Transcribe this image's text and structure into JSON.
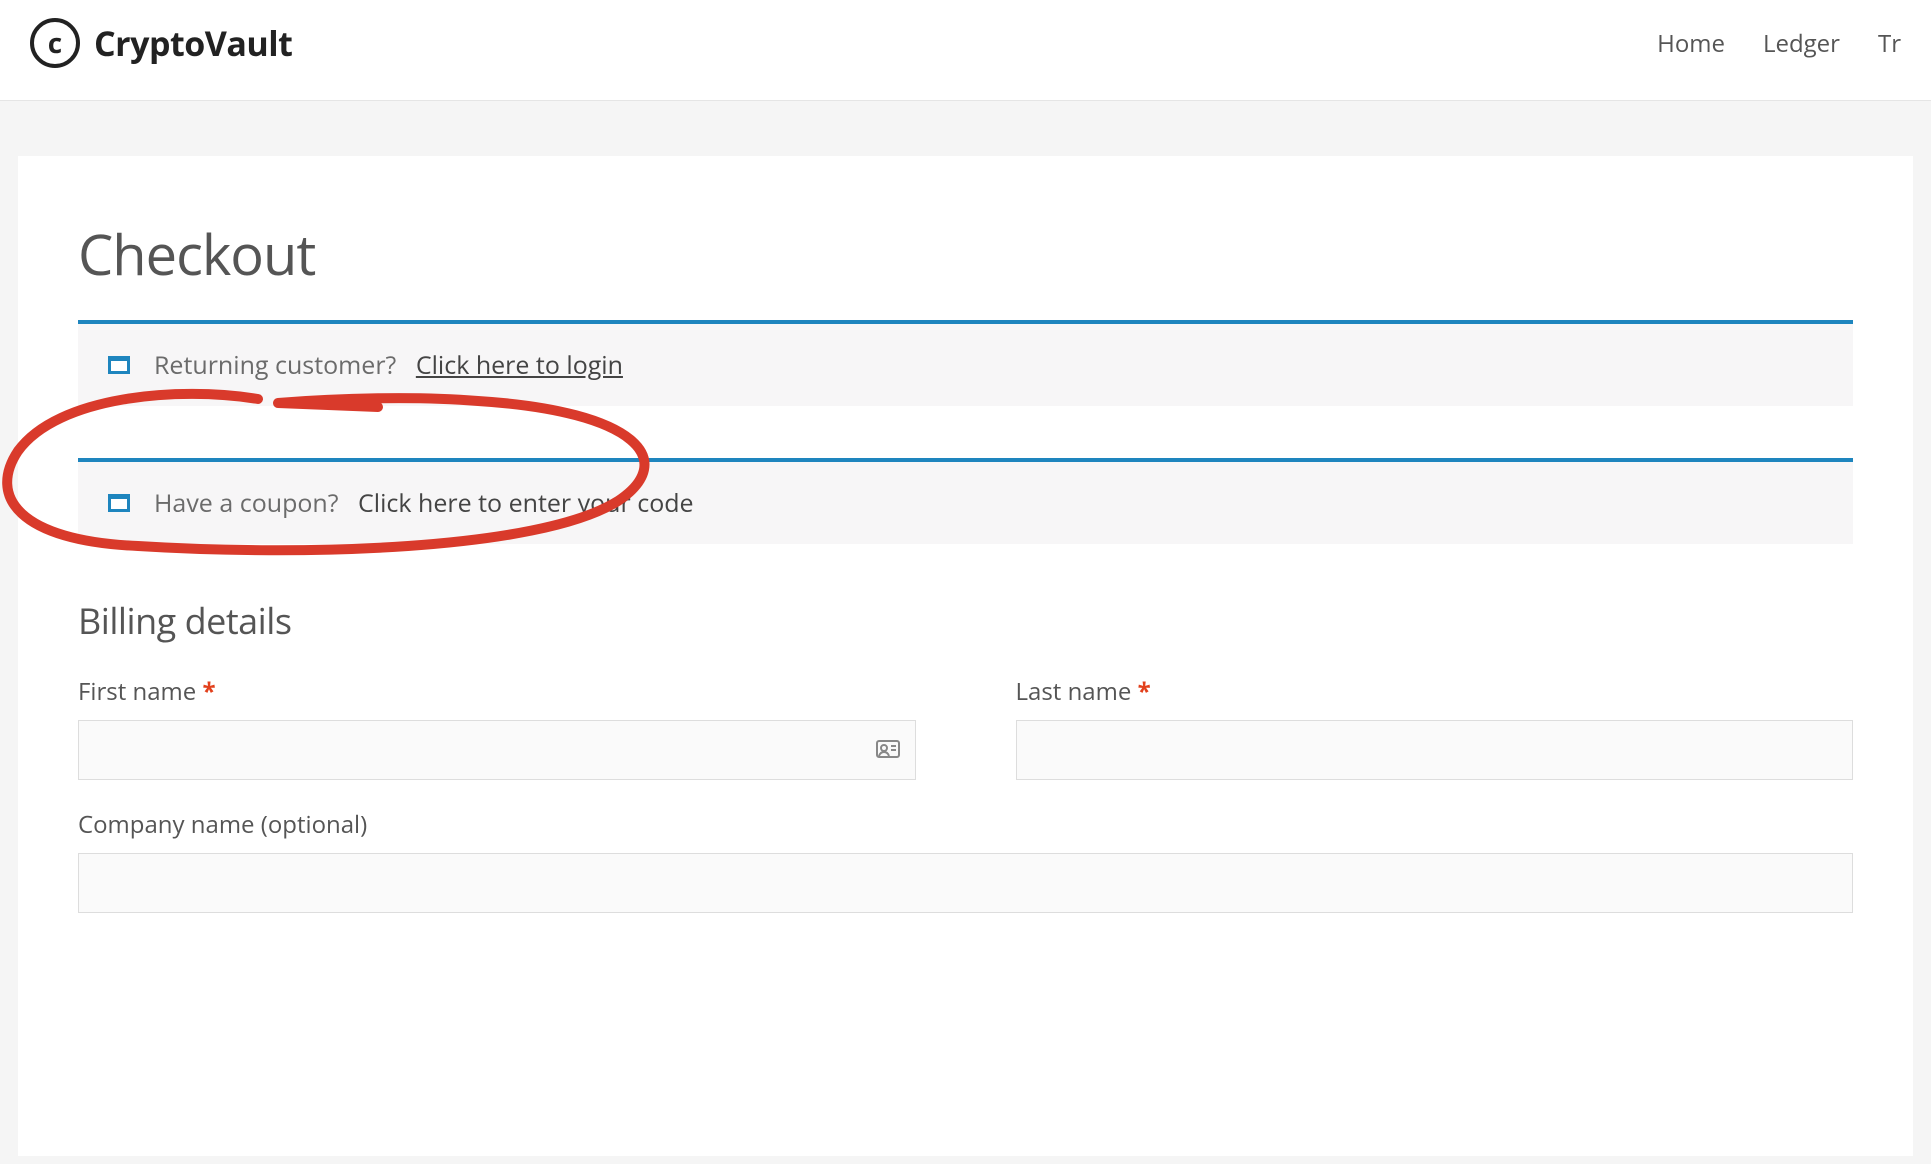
{
  "brand": {
    "name": "CryptoVault",
    "logo_glyph": "c"
  },
  "nav": {
    "items": [
      "Home",
      "Ledger",
      "Tr"
    ]
  },
  "page": {
    "title": "Checkout"
  },
  "login_notice": {
    "prompt": "Returning customer?",
    "link": "Click here to login"
  },
  "coupon_notice": {
    "prompt": "Have a coupon?",
    "link": "Click here to enter your code"
  },
  "billing": {
    "heading": "Billing details",
    "first_name_label": "First name",
    "last_name_label": "Last name",
    "company_label": "Company name (optional)"
  }
}
